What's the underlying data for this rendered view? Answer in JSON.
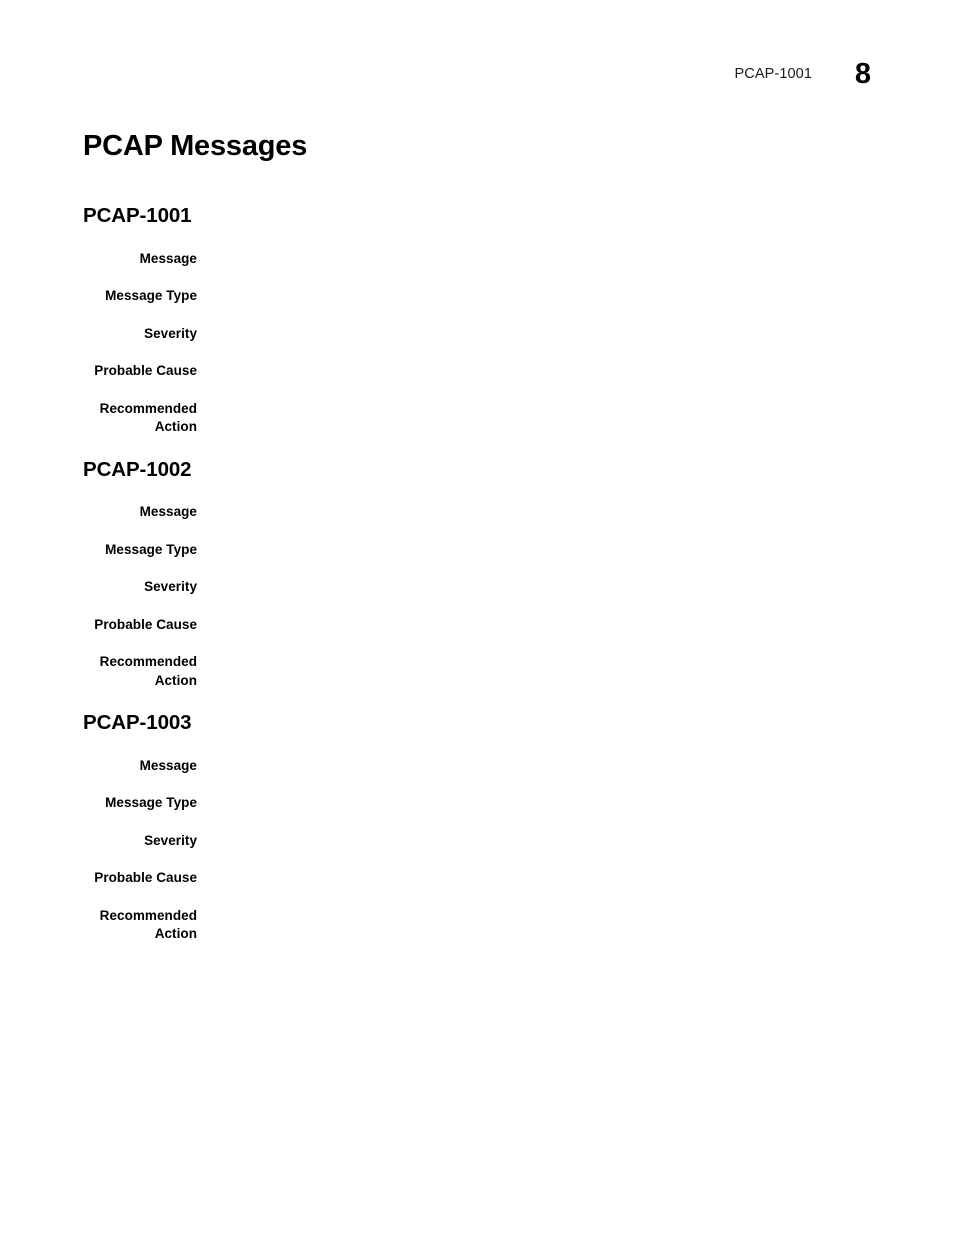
{
  "header": {
    "reference": "PCAP-1001",
    "page_number": "8"
  },
  "document": {
    "title": "PCAP Messages"
  },
  "field_labels": {
    "message": "Message",
    "message_type": "Message Type",
    "severity": "Severity",
    "probable_cause": "Probable Cause",
    "recommended_action": "Recommended\nAction"
  },
  "sections": [
    {
      "heading": "PCAP-1001",
      "fields": {
        "message": "",
        "message_type": "",
        "severity": "",
        "probable_cause": "",
        "recommended_action": ""
      }
    },
    {
      "heading": "PCAP-1002",
      "fields": {
        "message": "",
        "message_type": "",
        "severity": "",
        "probable_cause": "",
        "recommended_action": ""
      }
    },
    {
      "heading": "PCAP-1003",
      "fields": {
        "message": "",
        "message_type": "",
        "severity": "",
        "probable_cause": "",
        "recommended_action": ""
      }
    }
  ]
}
